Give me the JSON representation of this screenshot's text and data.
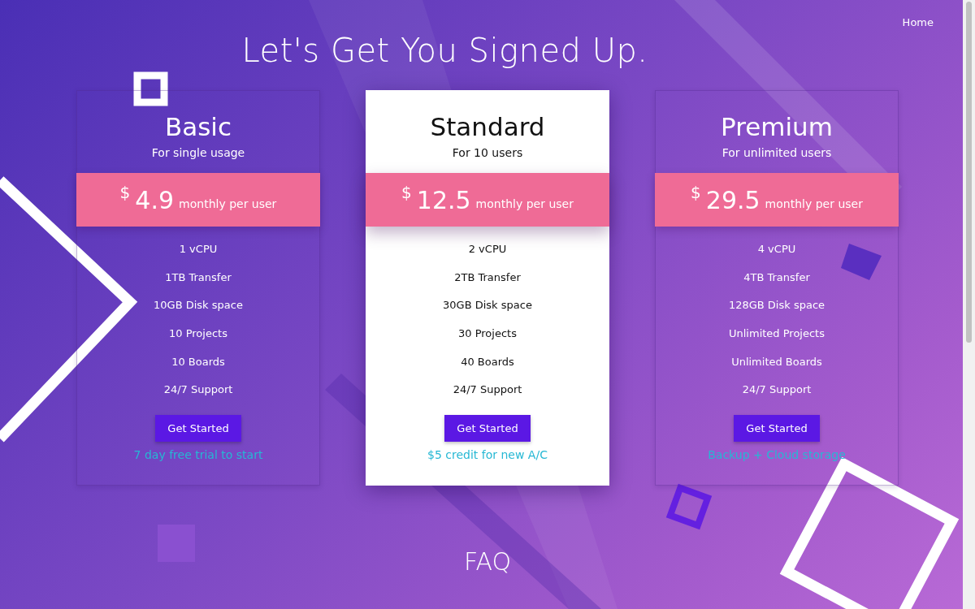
{
  "nav": {
    "home": "Home"
  },
  "title": "Let's Get You Signed Up.",
  "plans": [
    {
      "name": "Basic",
      "subtitle": "For single usage",
      "currency": "$",
      "price": "4.9",
      "period": "monthly per user",
      "highlighted": false,
      "features": [
        "1 vCPU",
        "1TB Transfer",
        "10GB Disk space",
        "10 Projects",
        "10 Boards",
        "24/7 Support"
      ],
      "button": "Get Started",
      "note": "7 day free trial to start"
    },
    {
      "name": "Standard",
      "subtitle": "For 10 users",
      "currency": "$",
      "price": "12.5",
      "period": "monthly per user",
      "highlighted": true,
      "features": [
        "2 vCPU",
        "2TB Transfer",
        "30GB Disk space",
        "30 Projects",
        "40 Boards",
        "24/7 Support"
      ],
      "button": "Get Started",
      "note": "$5 credit for new A/C"
    },
    {
      "name": "Premium",
      "subtitle": "For unlimited users",
      "currency": "$",
      "price": "29.5",
      "period": "monthly per user",
      "highlighted": false,
      "features": [
        "4 vCPU",
        "4TB Transfer",
        "128GB Disk space",
        "Unlimited Projects",
        "Unlimited Boards",
        "24/7 Support"
      ],
      "button": "Get Started",
      "note": "Backup + Cloud storage"
    }
  ],
  "faq": {
    "title": "FAQ"
  }
}
